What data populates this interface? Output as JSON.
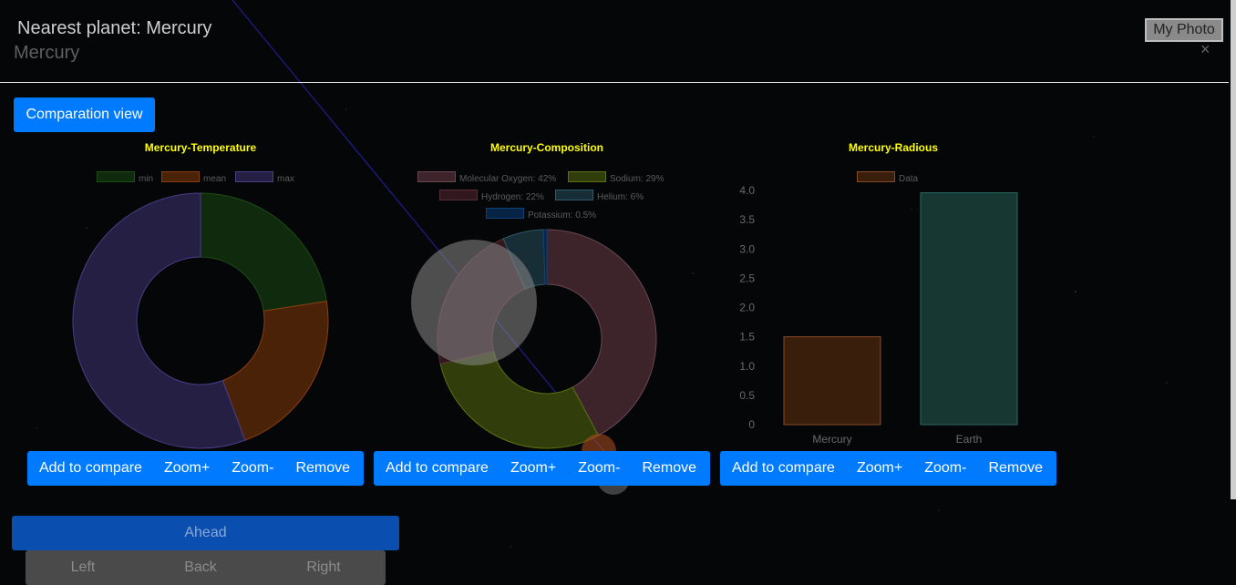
{
  "modal": {
    "title": "Nearest planet: Mercury",
    "subtitle": "Mercury",
    "close_icon": "×",
    "photo_button": "My Photo",
    "compare_view_button": "Comparation view"
  },
  "charts": [
    {
      "title": "Mercury-Temperature",
      "type": "doughnut",
      "legend": [
        "min",
        "mean",
        "max"
      ],
      "buttons": [
        "Add to compare",
        "Zoom+",
        "Zoom-",
        "Remove"
      ]
    },
    {
      "title": "Mercury-Composition",
      "type": "doughnut",
      "legend": [
        "Molecular Oxygen: 42%",
        "Sodium: 29%",
        "Hydrogen: 22%",
        "Helium: 6%",
        "Potassium: 0.5%"
      ],
      "buttons": [
        "Add to compare",
        "Zoom+",
        "Zoom-",
        "Remove"
      ]
    },
    {
      "title": "Mercury-Radious",
      "type": "bar",
      "legend": [
        "Data"
      ],
      "buttons": [
        "Add to compare",
        "Zoom+",
        "Zoom-",
        "Remove"
      ]
    }
  ],
  "navigation": {
    "ahead": "Ahead",
    "left": "Left",
    "back": "Back",
    "right": "Right"
  },
  "colors": {
    "accent": "#007bff",
    "chart_title": "#ffff00",
    "temperature": [
      "#14330f",
      "#5a2a08",
      "#2e2552"
    ],
    "composition": [
      "#4d2c35",
      "#3e4d0c",
      "#3c1e26",
      "#1d3a44",
      "#0a2c55"
    ],
    "radius": [
      "#552c12",
      "#1d433e"
    ]
  },
  "chart_data": [
    {
      "type": "pie",
      "title": "Mercury-Temperature",
      "categories": [
        "min",
        "mean",
        "max"
      ],
      "values": [
        -173,
        167,
        427
      ]
    },
    {
      "type": "pie",
      "title": "Mercury-Composition",
      "categories": [
        "Molecular Oxygen",
        "Sodium",
        "Hydrogen",
        "Helium",
        "Potassium"
      ],
      "values": [
        42,
        29,
        22,
        6,
        0.5
      ]
    },
    {
      "type": "bar",
      "title": "Mercury-Radious",
      "categories": [
        "Mercury",
        "Earth"
      ],
      "series": [
        {
          "name": "Data",
          "values": [
            1.5,
            3.96
          ]
        }
      ],
      "ylim": [
        0,
        4
      ],
      "yticks": [
        "4.0",
        "3.5",
        "3.0",
        "2.5",
        "2.0",
        "1.5",
        "1.0",
        "0.5",
        "0"
      ]
    }
  ]
}
